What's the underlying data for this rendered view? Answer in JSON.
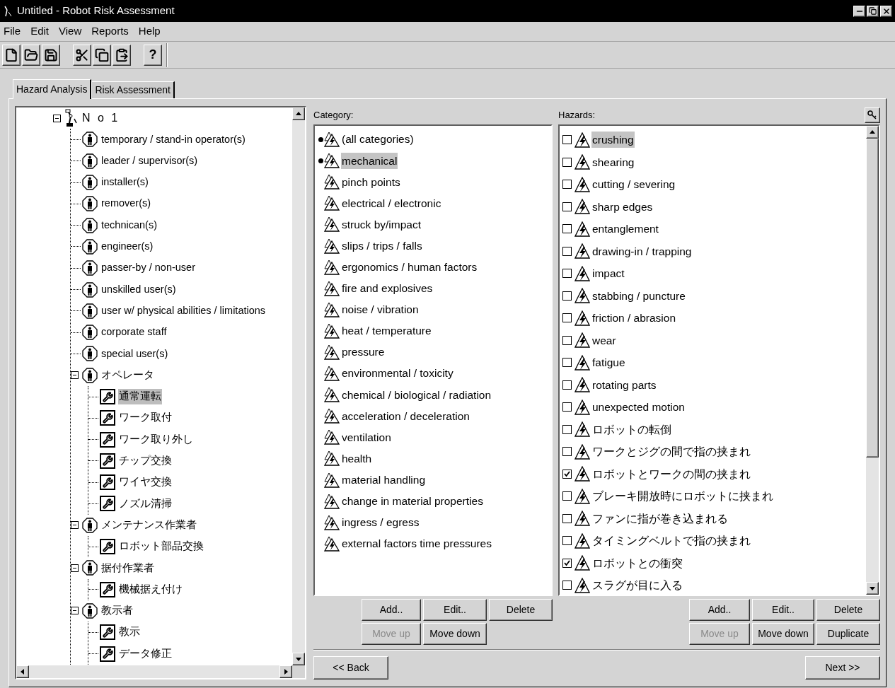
{
  "window": {
    "title": "Untitled - Robot Risk Assessment"
  },
  "menu": [
    {
      "label": "File"
    },
    {
      "label": "Edit"
    },
    {
      "label": "View"
    },
    {
      "label": "Reports"
    },
    {
      "label": "Help"
    }
  ],
  "toolbar": [
    {
      "kind": "new"
    },
    {
      "kind": "open"
    },
    {
      "kind": "save"
    },
    {
      "kind": "separator"
    },
    {
      "kind": "cut"
    },
    {
      "kind": "copy"
    },
    {
      "kind": "paste"
    },
    {
      "kind": "separator"
    },
    {
      "kind": "help",
      "label": "?"
    }
  ],
  "tabs": [
    {
      "label": "Hazard Analysis",
      "selected": true
    },
    {
      "label": "Risk Assessment",
      "selected": false
    }
  ],
  "tree": {
    "label": "N o 1",
    "kind": "robot",
    "expanded": true,
    "selected": false,
    "children": [
      {
        "label": "temporary / stand-in operator(s)",
        "kind": "person",
        "selected": false
      },
      {
        "label": "leader / supervisor(s)",
        "kind": "person",
        "selected": false
      },
      {
        "label": "installer(s)",
        "kind": "person",
        "selected": false
      },
      {
        "label": "remover(s)",
        "kind": "person",
        "selected": false
      },
      {
        "label": "technican(s)",
        "kind": "person",
        "selected": false
      },
      {
        "label": "engineer(s)",
        "kind": "person",
        "selected": false
      },
      {
        "label": "passer-by / non-user",
        "kind": "person",
        "selected": false
      },
      {
        "label": "unskilled user(s)",
        "kind": "person",
        "selected": false
      },
      {
        "label": "user w/ physical abilities / limitations",
        "kind": "person",
        "selected": false
      },
      {
        "label": "corporate staff",
        "kind": "person",
        "selected": false
      },
      {
        "label": "special user(s)",
        "kind": "person",
        "selected": false
      },
      {
        "label": "オペレータ",
        "kind": "person",
        "selected": false,
        "expanded": true,
        "children": [
          {
            "label": "通常運転",
            "kind": "task",
            "selected": true
          },
          {
            "label": "ワーク取付",
            "kind": "task",
            "selected": false
          },
          {
            "label": "ワーク取り外し",
            "kind": "task",
            "selected": false
          },
          {
            "label": "チップ交換",
            "kind": "task",
            "selected": false
          },
          {
            "label": "ワイヤ交換",
            "kind": "task",
            "selected": false
          },
          {
            "label": "ノズル清掃",
            "kind": "task",
            "selected": false
          }
        ]
      },
      {
        "label": "メンテナンス作業者",
        "kind": "person",
        "selected": false,
        "expanded": true,
        "children": [
          {
            "label": "ロボット部品交換",
            "kind": "task",
            "selected": false
          }
        ]
      },
      {
        "label": "据付作業者",
        "kind": "person",
        "selected": false,
        "expanded": true,
        "children": [
          {
            "label": "機械据え付け",
            "kind": "task",
            "selected": false
          }
        ]
      },
      {
        "label": "教示者",
        "kind": "person",
        "selected": false,
        "expanded": true,
        "children": [
          {
            "label": "教示",
            "kind": "task",
            "selected": false
          },
          {
            "label": "データ修正",
            "kind": "task",
            "selected": false
          }
        ]
      }
    ]
  },
  "category": {
    "label": "Category:",
    "items": [
      {
        "label": "(all categories)",
        "marked": true,
        "selected": false
      },
      {
        "label": "mechanical",
        "marked": true,
        "selected": true
      },
      {
        "label": "pinch points",
        "marked": false,
        "selected": false
      },
      {
        "label": "electrical / electronic",
        "marked": false,
        "selected": false
      },
      {
        "label": "struck by/impact",
        "marked": false,
        "selected": false
      },
      {
        "label": "slips / trips / falls",
        "marked": false,
        "selected": false
      },
      {
        "label": "ergonomics / human factors",
        "marked": false,
        "selected": false
      },
      {
        "label": "fire and explosives",
        "marked": false,
        "selected": false
      },
      {
        "label": "noise / vibration",
        "marked": false,
        "selected": false
      },
      {
        "label": "heat / temperature",
        "marked": false,
        "selected": false
      },
      {
        "label": "pressure",
        "marked": false,
        "selected": false
      },
      {
        "label": "environmental / toxicity",
        "marked": false,
        "selected": false
      },
      {
        "label": "chemical / biological / radiation",
        "marked": false,
        "selected": false
      },
      {
        "label": "acceleration / deceleration",
        "marked": false,
        "selected": false
      },
      {
        "label": "ventilation",
        "marked": false,
        "selected": false
      },
      {
        "label": "health",
        "marked": false,
        "selected": false
      },
      {
        "label": "material handling",
        "marked": false,
        "selected": false
      },
      {
        "label": "change in material properties",
        "marked": false,
        "selected": false
      },
      {
        "label": "ingress / egress",
        "marked": false,
        "selected": false
      },
      {
        "label": "external factors time pressures",
        "marked": false,
        "selected": false
      }
    ],
    "buttons": [
      {
        "label": "Add..",
        "disabled": false
      },
      {
        "label": "Edit..",
        "disabled": false
      },
      {
        "label": "Delete",
        "disabled": false
      },
      {
        "label": "Move up",
        "disabled": true
      },
      {
        "label": "Move down",
        "disabled": false
      }
    ]
  },
  "hazards": {
    "label": "Hazards:",
    "items": [
      {
        "label": "crushing",
        "checked": false,
        "selected": true
      },
      {
        "label": "shearing",
        "checked": false,
        "selected": false
      },
      {
        "label": "cutting / severing",
        "checked": false,
        "selected": false
      },
      {
        "label": "sharp edges",
        "checked": false,
        "selected": false
      },
      {
        "label": "entanglement",
        "checked": false,
        "selected": false
      },
      {
        "label": "drawing-in / trapping",
        "checked": false,
        "selected": false
      },
      {
        "label": "impact",
        "checked": false,
        "selected": false
      },
      {
        "label": "stabbing / puncture",
        "checked": false,
        "selected": false
      },
      {
        "label": "friction / abrasion",
        "checked": false,
        "selected": false
      },
      {
        "label": "wear",
        "checked": false,
        "selected": false
      },
      {
        "label": "fatigue",
        "checked": false,
        "selected": false
      },
      {
        "label": "rotating parts",
        "checked": false,
        "selected": false
      },
      {
        "label": "unexpected motion",
        "checked": false,
        "selected": false
      },
      {
        "label": "ロボットの転倒",
        "checked": false,
        "selected": false
      },
      {
        "label": "ワークとジグの間で指の挟まれ",
        "checked": false,
        "selected": false
      },
      {
        "label": "ロボットとワークの間の挟まれ",
        "checked": true,
        "selected": false
      },
      {
        "label": "ブレーキ開放時にロボットに挟まれ",
        "checked": false,
        "selected": false
      },
      {
        "label": "ファンに指が巻き込まれる",
        "checked": false,
        "selected": false
      },
      {
        "label": "タイミングベルトで指の挟まれ",
        "checked": false,
        "selected": false
      },
      {
        "label": "ロボットとの衝突",
        "checked": true,
        "selected": false
      },
      {
        "label": "スラグが目に入る",
        "checked": false,
        "selected": false
      }
    ],
    "buttons": [
      {
        "label": "Add..",
        "disabled": false
      },
      {
        "label": "Edit..",
        "disabled": false
      },
      {
        "label": "Delete",
        "disabled": false
      },
      {
        "label": "Move up",
        "disabled": true
      },
      {
        "label": "Move down",
        "disabled": false
      },
      {
        "label": "Duplicate",
        "disabled": false
      }
    ]
  },
  "navigation": [
    {
      "label": "<< Back"
    },
    {
      "label": "Next >>"
    }
  ]
}
